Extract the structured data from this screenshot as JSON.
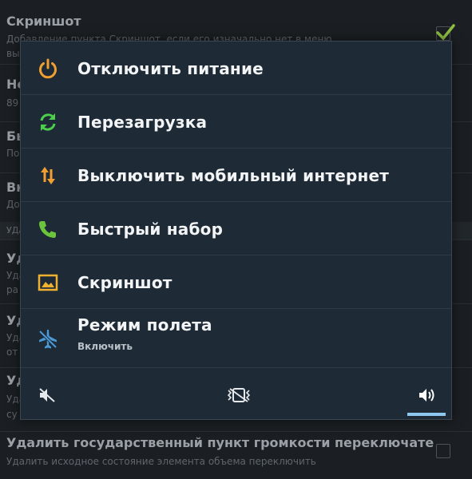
{
  "background": {
    "items": [
      {
        "title": "Скриншот",
        "subtitle": "Добавление пункта Скриншот, если его изначально нет в меню",
        "subtitle2": "вы",
        "checked": true
      },
      {
        "title": "Но",
        "subtitle": "89"
      },
      {
        "title": "Бы",
        "subtitle": "По"
      },
      {
        "title": "Вк",
        "subtitle": "До"
      },
      {
        "section": "УДА"
      },
      {
        "title": "Уд",
        "subtitle": "Уда",
        "subtitle2": "ра"
      },
      {
        "title": "Уд",
        "subtitle": "Уда",
        "subtitle2": "от"
      },
      {
        "title": "Уд",
        "subtitle": "Уда",
        "subtitle2": "су"
      },
      {
        "title": "Удалить государственный пункт громкости переключате",
        "subtitle": "Удалить исходное состояние элемента объема переключить",
        "checked": false
      }
    ]
  },
  "dialog": {
    "items": [
      {
        "label": "Отключить питание",
        "icon": "power-icon",
        "color": "#f0a030"
      },
      {
        "label": "Перезагрузка",
        "icon": "reboot-icon",
        "color": "#4cd04c"
      },
      {
        "label": "Выключить мобильный интернет",
        "icon": "mobile-data-icon",
        "color": "#f0a030"
      },
      {
        "label": "Быстрый набор",
        "icon": "phone-icon",
        "color": "#6cc43c"
      },
      {
        "label": "Скриншот",
        "icon": "screenshot-icon",
        "color": "#f0b030"
      },
      {
        "label": "Режим полета",
        "sublabel": "Включить",
        "icon": "airplane-off-icon",
        "color": "#4a9ad8"
      }
    ],
    "sound_modes": [
      {
        "icon": "silent-icon",
        "selected": false
      },
      {
        "icon": "vibrate-icon",
        "selected": false
      },
      {
        "icon": "sound-on-icon",
        "selected": true
      }
    ],
    "accent": "#8fc8ee"
  }
}
